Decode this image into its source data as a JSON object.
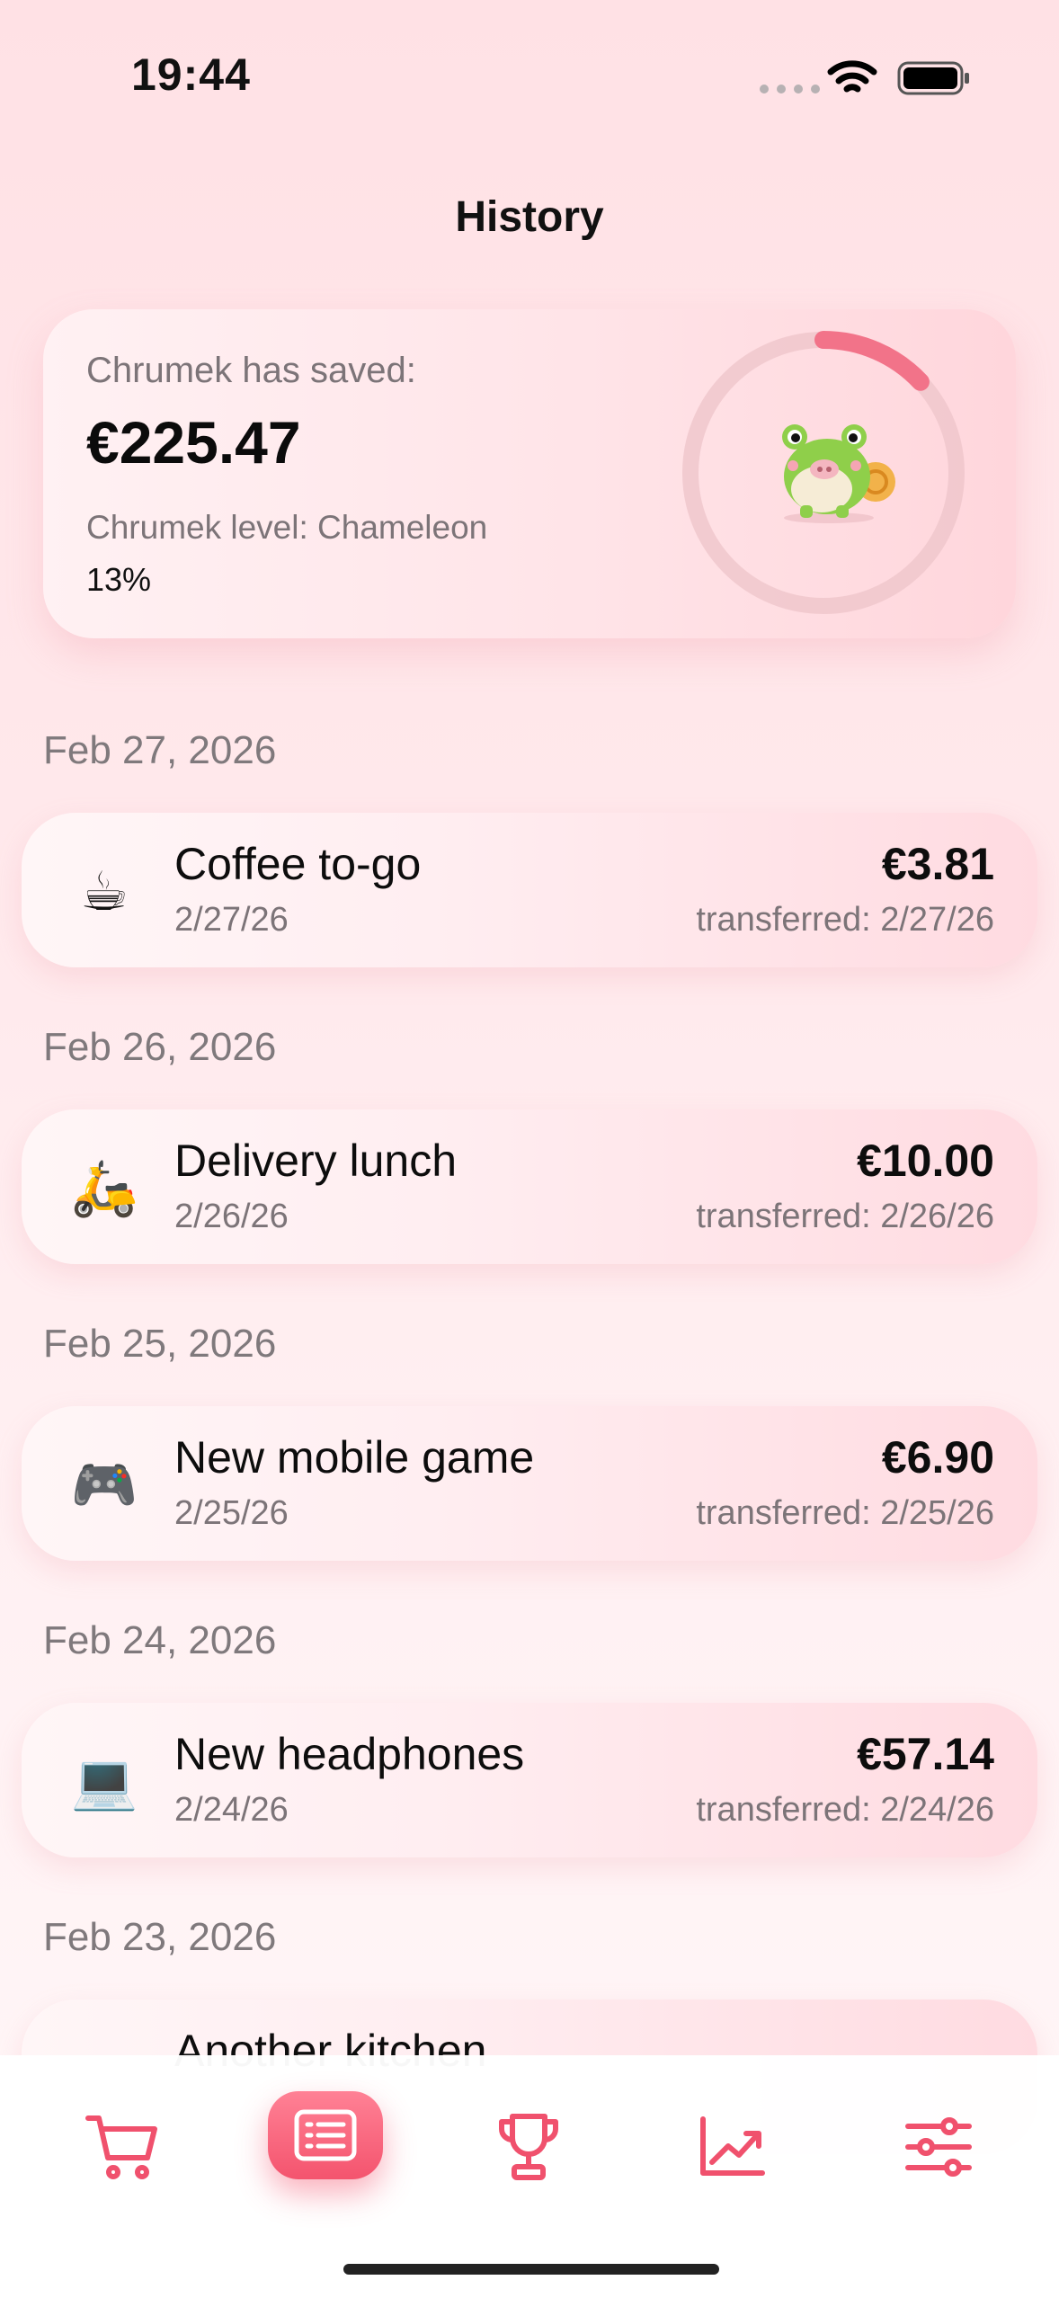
{
  "status_bar": {
    "time": "19:44"
  },
  "header": {
    "title": "History"
  },
  "summary": {
    "saved_label": "Chrumek has saved:",
    "saved_amount": "€225.47",
    "level_label": "Chrumek level: Chameleon",
    "level_percent": "13%",
    "progress_fraction": 0.13,
    "accent_color": "#f27389",
    "mascot": "chameleon-pig-icon"
  },
  "groups": [
    {
      "date": "Feb 27, 2026",
      "entry": {
        "icon": "☕",
        "icon_name": "coffee-icon",
        "title": "Coffee to-go",
        "date": "2/27/26",
        "amount": "€3.81",
        "transferred": "transferred: 2/27/26"
      }
    },
    {
      "date": "Feb 26, 2026",
      "entry": {
        "icon": "🛵",
        "icon_name": "scooter-icon",
        "title": "Delivery lunch",
        "date": "2/26/26",
        "amount": "€10.00",
        "transferred": "transferred: 2/26/26"
      }
    },
    {
      "date": "Feb 25, 2026",
      "entry": {
        "icon": "🎮",
        "icon_name": "game-controller-icon",
        "title": "New mobile game",
        "date": "2/25/26",
        "amount": "€6.90",
        "transferred": "transferred: 2/25/26"
      }
    },
    {
      "date": "Feb 24, 2026",
      "entry": {
        "icon": "💻",
        "icon_name": "laptop-icon",
        "title": "New headphones",
        "date": "2/24/26",
        "amount": "€57.14",
        "transferred": "transferred: 2/24/26"
      }
    },
    {
      "date": "Feb 23, 2026",
      "entry": {
        "icon": "",
        "icon_name": "",
        "title": "Another kitchen",
        "date": "",
        "amount": "",
        "transferred": ""
      }
    }
  ],
  "nav": {
    "items": [
      {
        "name": "cart-icon",
        "active": false
      },
      {
        "name": "history-list-icon",
        "active": true
      },
      {
        "name": "trophy-icon",
        "active": false
      },
      {
        "name": "chart-trend-icon",
        "active": false
      },
      {
        "name": "sliders-icon",
        "active": false
      }
    ],
    "accent_color": "#f0516d"
  }
}
